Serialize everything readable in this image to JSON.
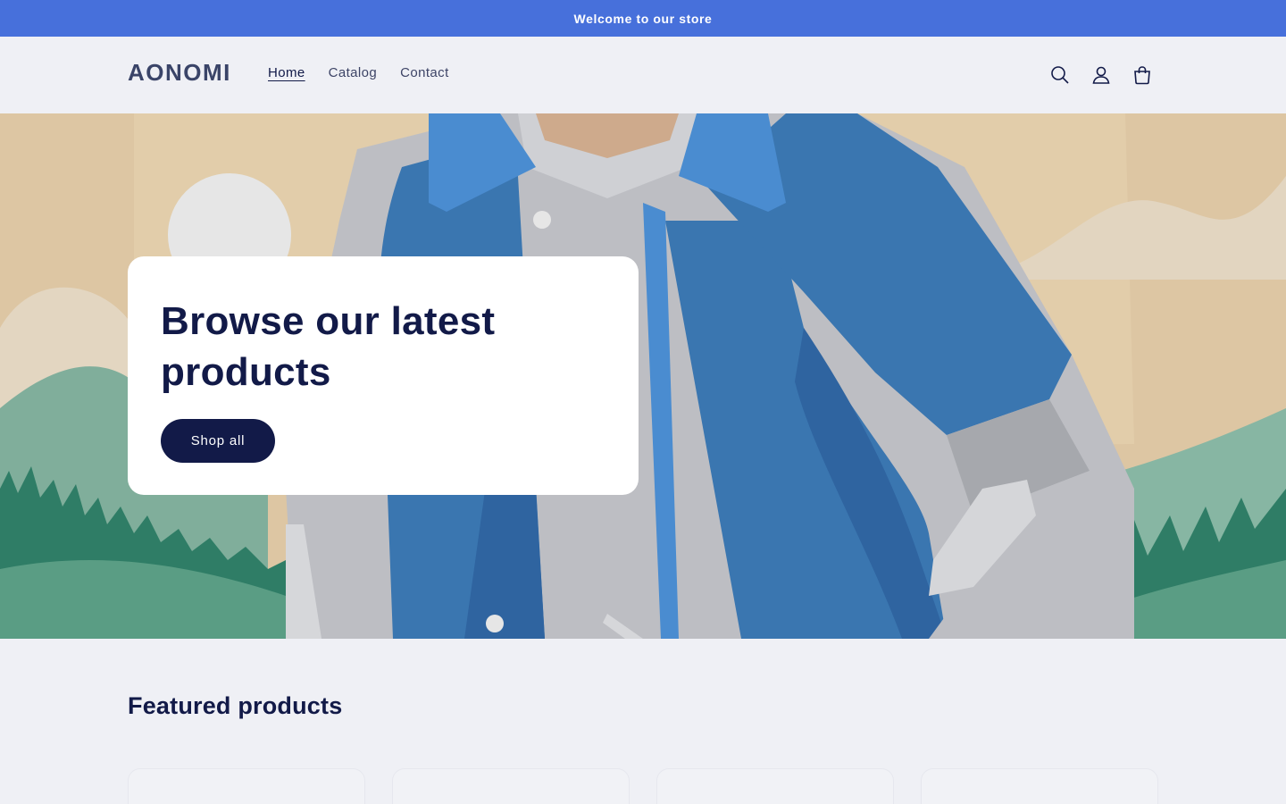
{
  "announcement": {
    "text": "Welcome to our store"
  },
  "header": {
    "logo": "AONOMI",
    "nav": [
      {
        "label": "Home",
        "active": true
      },
      {
        "label": "Catalog",
        "active": false
      },
      {
        "label": "Contact",
        "active": false
      }
    ],
    "icons": [
      "search-icon",
      "account-icon",
      "cart-icon"
    ]
  },
  "hero": {
    "heading": "Browse our latest products",
    "button_label": "Shop all"
  },
  "featured": {
    "title": "Featured products",
    "product_count": 4
  },
  "colors": {
    "announcement_bg": "#4770db",
    "page_bg": "#eff0f5",
    "primary_dark": "#121a48",
    "jacket_blue": "#3a76b0"
  }
}
